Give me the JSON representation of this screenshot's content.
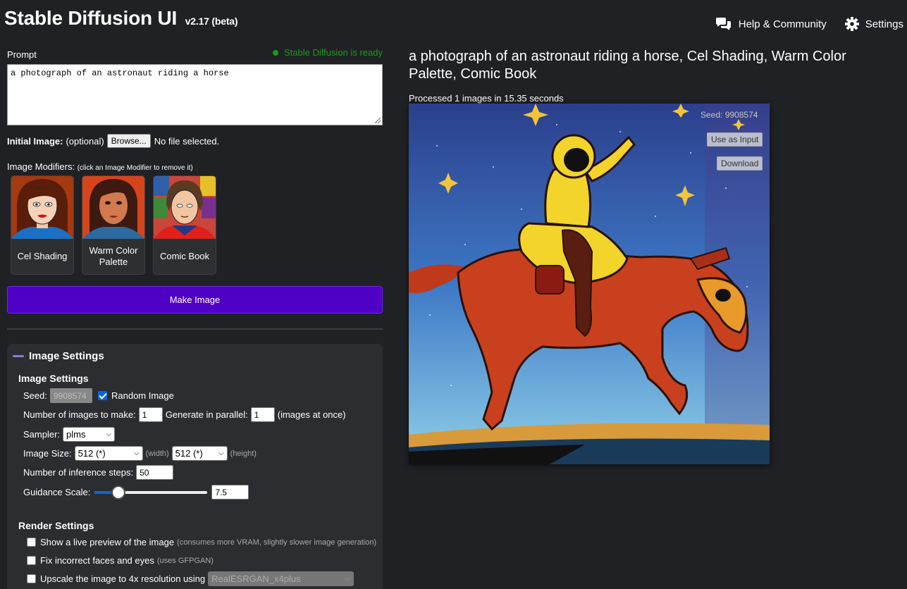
{
  "header": {
    "title": "Stable Diffusion UI",
    "version": "v2.17 (beta)",
    "links": [
      {
        "label": "Help & Community",
        "icon": "chat-bubbles-icon"
      },
      {
        "label": "Settings",
        "icon": "gear-icon"
      }
    ]
  },
  "prompt": {
    "label": "Prompt",
    "status": "Stable Diffusion is ready",
    "status_color": "#12a012",
    "value": "a photograph of an astronaut riding a horse"
  },
  "initial_image": {
    "label": "Initial Image:",
    "optional": "(optional)",
    "browse": "Browse...",
    "file_status": "No file selected."
  },
  "modifiers": {
    "label": "Image Modifiers:",
    "hint": "(click an Image Modifier to remove it)",
    "items": [
      {
        "label": "Cel Shading"
      },
      {
        "label": "Warm Color Palette"
      },
      {
        "label": "Comic Book"
      }
    ]
  },
  "make_image": {
    "label": "Make Image",
    "color": "#5000c5"
  },
  "image_settings": {
    "panel_title": "Image Settings",
    "section_title": "Image Settings",
    "seed_label": "Seed:",
    "seed_value": "9908574",
    "random_label": "Random Image",
    "random_checked": true,
    "num_images_label": "Number of images to make:",
    "num_images": "1",
    "parallel_label": "Generate in parallel:",
    "parallel": "1",
    "parallel_hint": "(images at once)",
    "sampler_label": "Sampler:",
    "sampler": "plms",
    "size_label": "Image Size:",
    "width": "512 (*)",
    "width_hint": "(width)",
    "height": "512 (*)",
    "height_hint": "(height)",
    "steps_label": "Number of inference steps:",
    "steps": "50",
    "guidance_label": "Guidance Scale:",
    "guidance": "7.5",
    "guidance_fraction": 0.17
  },
  "render_settings": {
    "title": "Render Settings",
    "live_preview": "Show a live preview of the image",
    "live_preview_hint": "(consumes more VRAM, slightly slower image generation)",
    "fix_faces": "Fix incorrect faces and eyes",
    "fix_faces_hint": "(uses GFPGAN)",
    "upscale": "Upscale the image to 4x resolution using",
    "upscale_model": "RealESRGAN_x4plus"
  },
  "result": {
    "title": "a photograph of an astronaut riding a horse, Cel Shading, Warm Color Palette, Comic Book",
    "processed": "Processed 1 images in 15.35 seconds",
    "seed": "Seed: 9908574",
    "use_as_input": "Use as Input",
    "download": "Download"
  }
}
